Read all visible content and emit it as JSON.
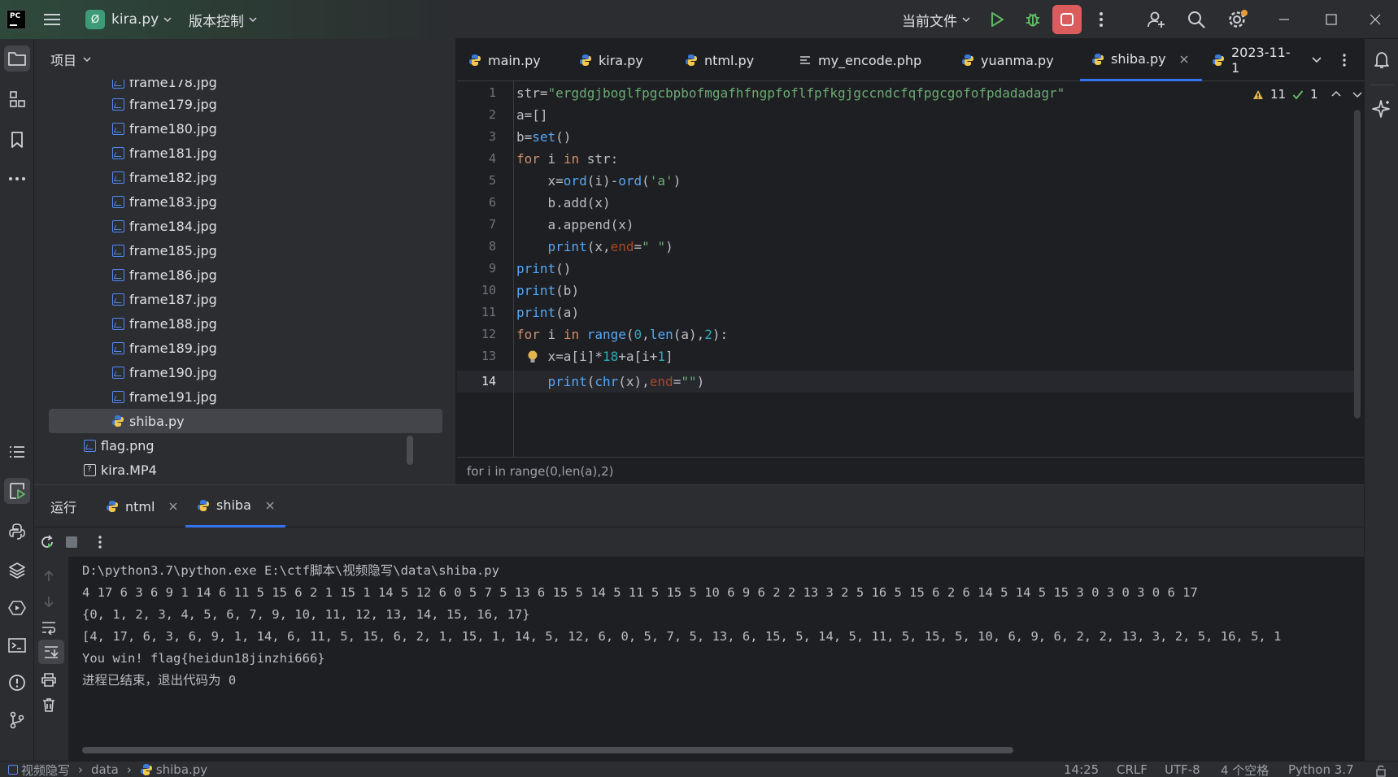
{
  "titlebar": {
    "project_badge": "Ø",
    "project_name": "kira.py",
    "vcs_menu": "版本控制",
    "run_config": "当前文件"
  },
  "project": {
    "header": "项目",
    "files": [
      "frame178.jpg",
      "frame179.jpg",
      "frame180.jpg",
      "frame181.jpg",
      "frame182.jpg",
      "frame183.jpg",
      "frame184.jpg",
      "frame185.jpg",
      "frame186.jpg",
      "frame187.jpg",
      "frame188.jpg",
      "frame189.jpg",
      "frame190.jpg",
      "frame191.jpg"
    ],
    "selected_file": "shiba.py",
    "root_files": [
      "flag.png",
      "kira.MP4"
    ]
  },
  "editor_tabs": [
    "main.py",
    "kira.py",
    "ntml.py",
    "my_encode.php",
    "yuanma.py",
    "shiba.py",
    "2023-11-1"
  ],
  "editor": {
    "active_tab": "shiba.py",
    "warnings": "11",
    "checks": "1",
    "line_numbers": [
      "1",
      "2",
      "3",
      "4",
      "5",
      "6",
      "7",
      "8",
      "9",
      "10",
      "11",
      "12",
      "13",
      "14"
    ],
    "code_text": [
      "str=\"ergdgjboglfpgcbpbofmgafhfngpfoflfpfkgjgccndcfqfpgcgofofpdadadagr\"",
      "a=[]",
      "b=set()",
      "for i in str:",
      "    x=ord(i)-ord('a')",
      "    b.add(x)",
      "    a.append(x)",
      "    print(x,end=\" \")",
      "print()",
      "print(b)",
      "print(a)",
      "for i in range(0,len(a),2):",
      "    x=a[i]*18+a[i+1]",
      "    print(chr(x),end=\"\")"
    ],
    "breadcrumb": "for i in range(0,len(a),2)"
  },
  "run": {
    "label": "运行",
    "tabs": [
      "ntml",
      "shiba"
    ],
    "active_tab": "shiba",
    "output": [
      "D:\\python3.7\\python.exe E:\\ctf脚本\\视频隐写\\data\\shiba.py",
      "4 17 6 3 6 9 1 14 6 11 5 15 6 2 1 15 1 14 5 12 6 0 5 7 5 13 6 15 5 14 5 11 5 15 5 10 6 9 6 2 2 13 3 2 5 16 5 15 6 2 6 14 5 14 5 15 3 0 3 0 3 0 6 17",
      "{0, 1, 2, 3, 4, 5, 6, 7, 9, 10, 11, 12, 13, 14, 15, 16, 17}",
      "[4, 17, 6, 3, 6, 9, 1, 14, 6, 11, 5, 15, 6, 2, 1, 15, 1, 14, 5, 12, 6, 0, 5, 7, 5, 13, 6, 15, 5, 14, 5, 11, 5, 15, 5, 10, 6, 9, 6, 2, 2, 13, 3, 2, 5, 16, 5, 1",
      "You win! flag{heidun18jinzhi666}",
      "进程已结束，退出代码为 0"
    ]
  },
  "statusbar": {
    "crumbs": [
      "视频隐写",
      "data",
      "shiba.py"
    ],
    "position": "14:25",
    "line_sep": "CRLF",
    "encoding": "UTF-8",
    "indent": "4 个空格",
    "interpreter": "Python 3.7"
  },
  "colors": {
    "accent": "#3574f0",
    "stop_button": "#db5c5c",
    "run_green": "#5fb865",
    "warning": "#e2b54f",
    "notif_dot": "#e89b3a"
  }
}
